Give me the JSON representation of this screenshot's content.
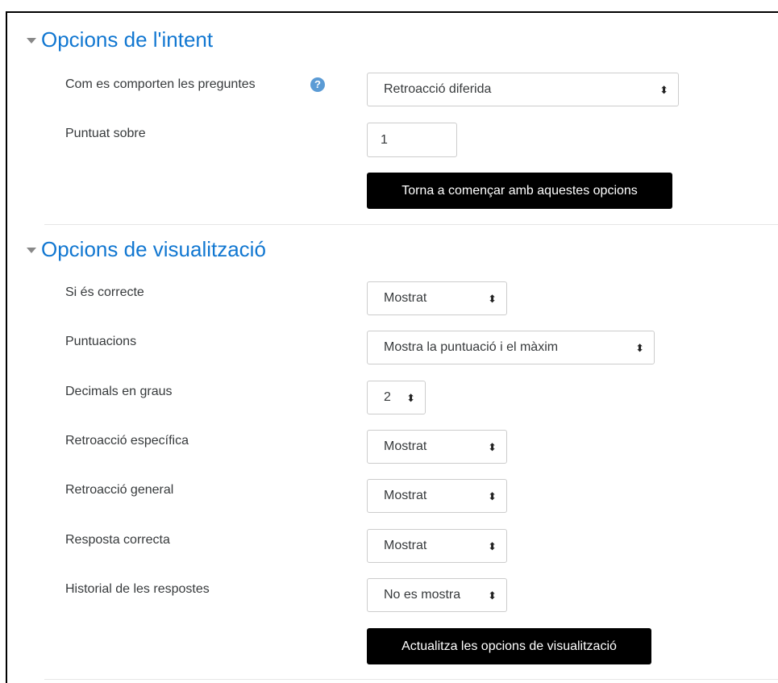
{
  "sections": {
    "attempt": {
      "title": "Opcions de l'intent",
      "behaviour_label": "Com es comporten les preguntes",
      "behaviour_value": "Retroacció diferida",
      "marked_out_of_label": "Puntuat sobre",
      "marked_out_of_value": "1",
      "restart_button": "Torna a començar amb aquestes opcions"
    },
    "display": {
      "title": "Opcions de visualització",
      "rows": [
        {
          "label": "Si és correcte",
          "value": "Mostrat"
        },
        {
          "label": "Puntuacions",
          "value": "Mostra la puntuació i el màxim"
        },
        {
          "label": "Decimals en graus",
          "value": "2"
        },
        {
          "label": "Retroacció específica",
          "value": "Mostrat"
        },
        {
          "label": "Retroacció general",
          "value": "Mostrat"
        },
        {
          "label": "Resposta correcta",
          "value": "Mostrat"
        },
        {
          "label": "Historial de les respostes",
          "value": "No es mostra"
        }
      ],
      "update_button": "Actualitza les opcions de visualització"
    }
  },
  "icons": {
    "help": "?",
    "select_arrows": "⬍",
    "collapse": "caret-down"
  },
  "colors": {
    "heading": "#1177d1",
    "help_icon": "#5b9bd5",
    "button_bg": "#000000"
  }
}
